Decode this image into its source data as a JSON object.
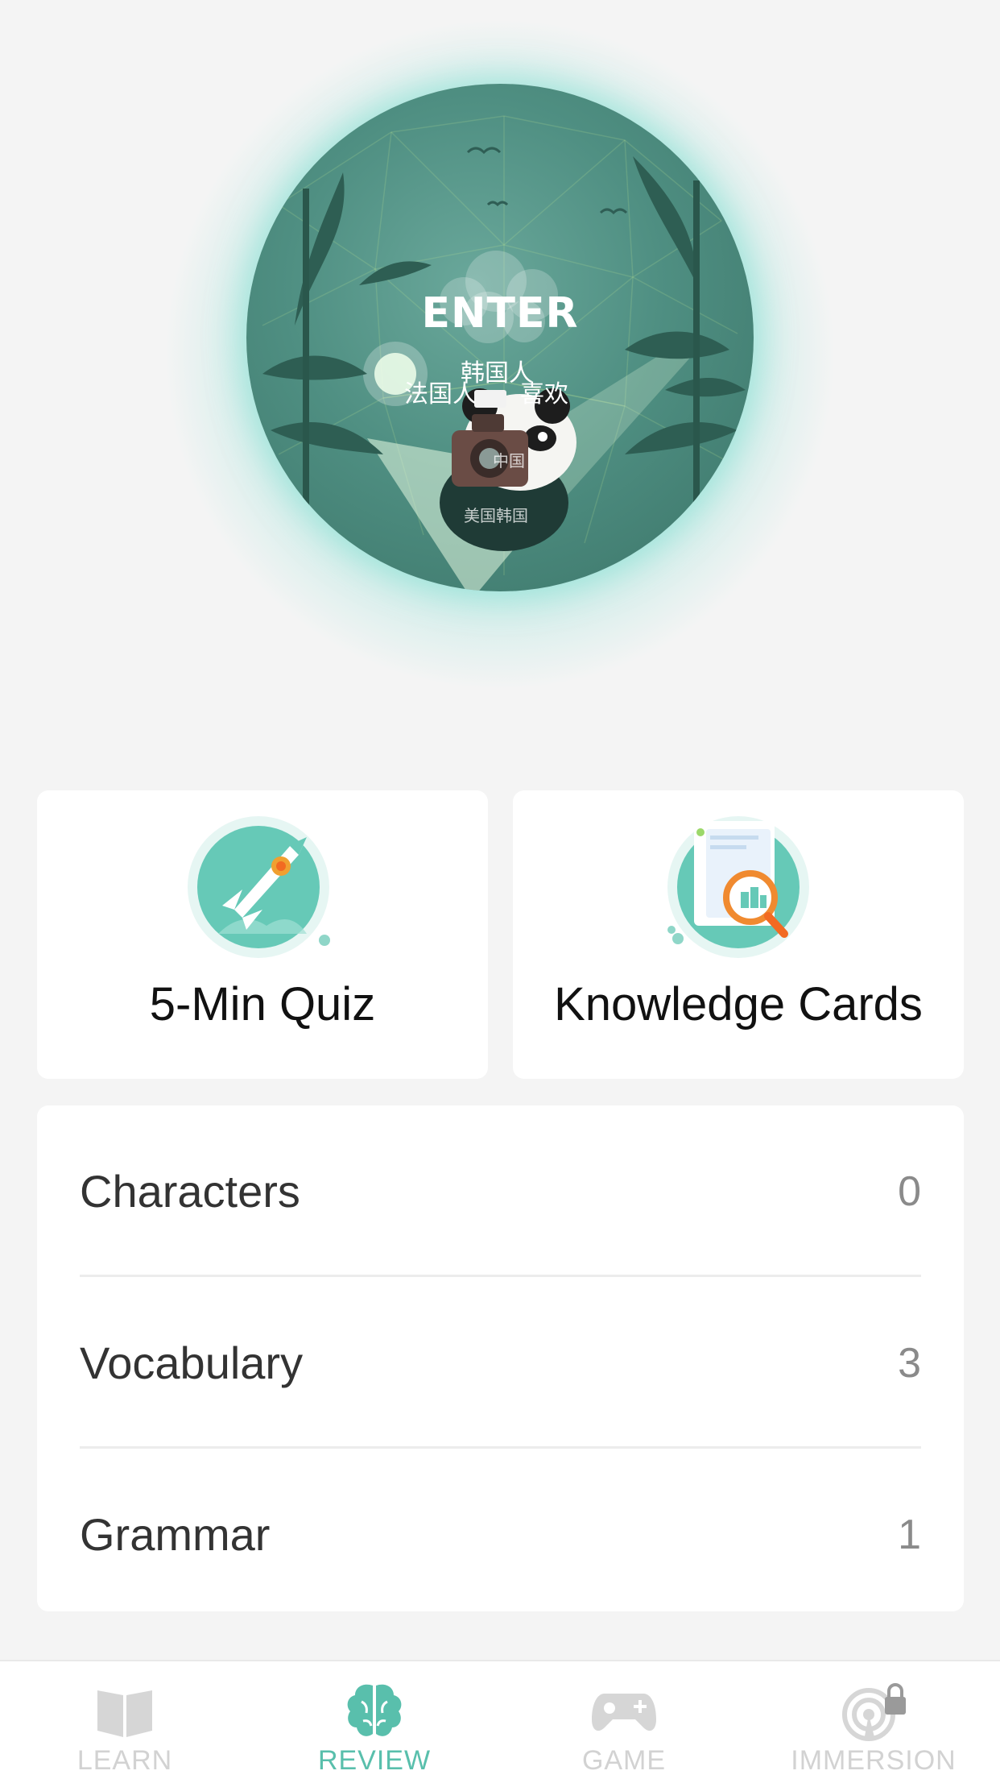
{
  "hero": {
    "enter_label": "ENTER",
    "words": [
      "韩国人",
      "法国人",
      "喜欢",
      "中国",
      "美国韩国"
    ]
  },
  "cards": {
    "quiz": {
      "label": "5-Min Quiz",
      "icon": "rocket-icon"
    },
    "knowledge": {
      "label": "Knowledge Cards",
      "icon": "magnifier-card-icon"
    }
  },
  "review": {
    "rows": [
      {
        "label": "Characters",
        "count": "0"
      },
      {
        "label": "Vocabulary",
        "count": "3"
      },
      {
        "label": "Grammar",
        "count": "1"
      }
    ]
  },
  "tabs": [
    {
      "label": "LEARN",
      "icon": "book-icon",
      "active": false
    },
    {
      "label": "REVIEW",
      "icon": "brain-icon",
      "active": true
    },
    {
      "label": "GAME",
      "icon": "gamepad-icon",
      "active": false
    },
    {
      "label": "IMMERSION",
      "icon": "radar-lock-icon",
      "active": false,
      "locked": true
    }
  ],
  "colors": {
    "accent": "#59bfac",
    "globe": "#4f8f82",
    "inactive_tab": "#d2d2d2",
    "background": "#f4f4f4"
  }
}
